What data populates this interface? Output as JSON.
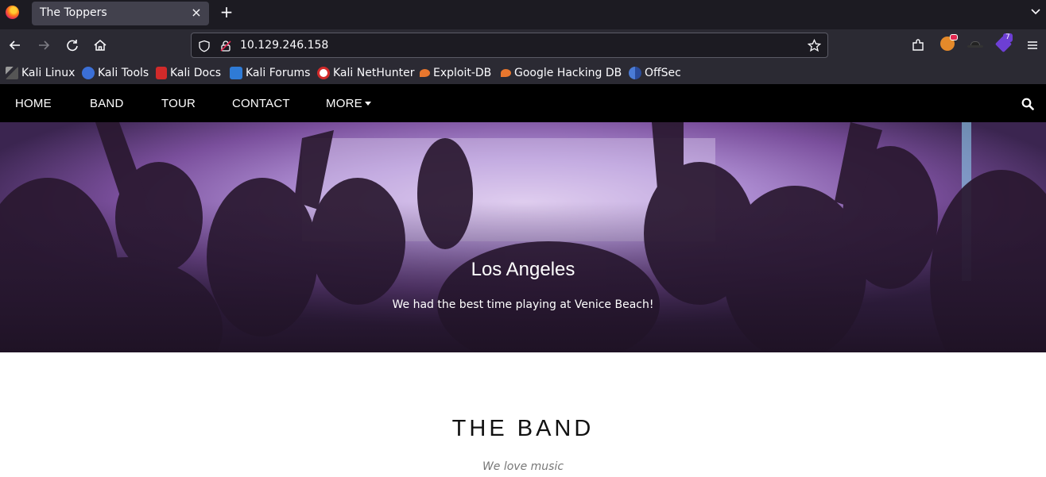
{
  "browser": {
    "tab": {
      "title": "The Toppers",
      "close": "×"
    },
    "new_tab": "+",
    "url": "10.129.246.158",
    "extension_badge": "7",
    "bookmarks": [
      {
        "label": "Kali Linux",
        "icon": "kali-dragon-icon",
        "color": "#9a9a9a"
      },
      {
        "label": "Kali Tools",
        "icon": "kali-tools-icon",
        "color": "#3b6fd6"
      },
      {
        "label": "Kali Docs",
        "icon": "kali-docs-icon",
        "color": "#d12a2a"
      },
      {
        "label": "Kali Forums",
        "icon": "kali-forums-icon",
        "color": "#2f7bd6"
      },
      {
        "label": "Kali NetHunter",
        "icon": "nethunter-icon",
        "color": "#d12a2a"
      },
      {
        "label": "Exploit-DB",
        "icon": "exploit-db-icon",
        "color": "#e8772e"
      },
      {
        "label": "Google Hacking DB",
        "icon": "ghdb-icon",
        "color": "#e8772e"
      },
      {
        "label": "OffSec",
        "icon": "offsec-icon",
        "color": "#4a7bd6"
      }
    ]
  },
  "site": {
    "nav": {
      "items": [
        "HOME",
        "BAND",
        "TOUR",
        "CONTACT",
        "MORE"
      ]
    },
    "hero": {
      "title": "Los Angeles",
      "subtitle": "We had the best time playing at Venice Beach!"
    },
    "band": {
      "title": "THE BAND",
      "subtitle": "We love music"
    }
  },
  "colors": {
    "browser_tabbar": "#1c1b22",
    "browser_toolbar": "#2b2a33",
    "site_nav": "#000000"
  }
}
